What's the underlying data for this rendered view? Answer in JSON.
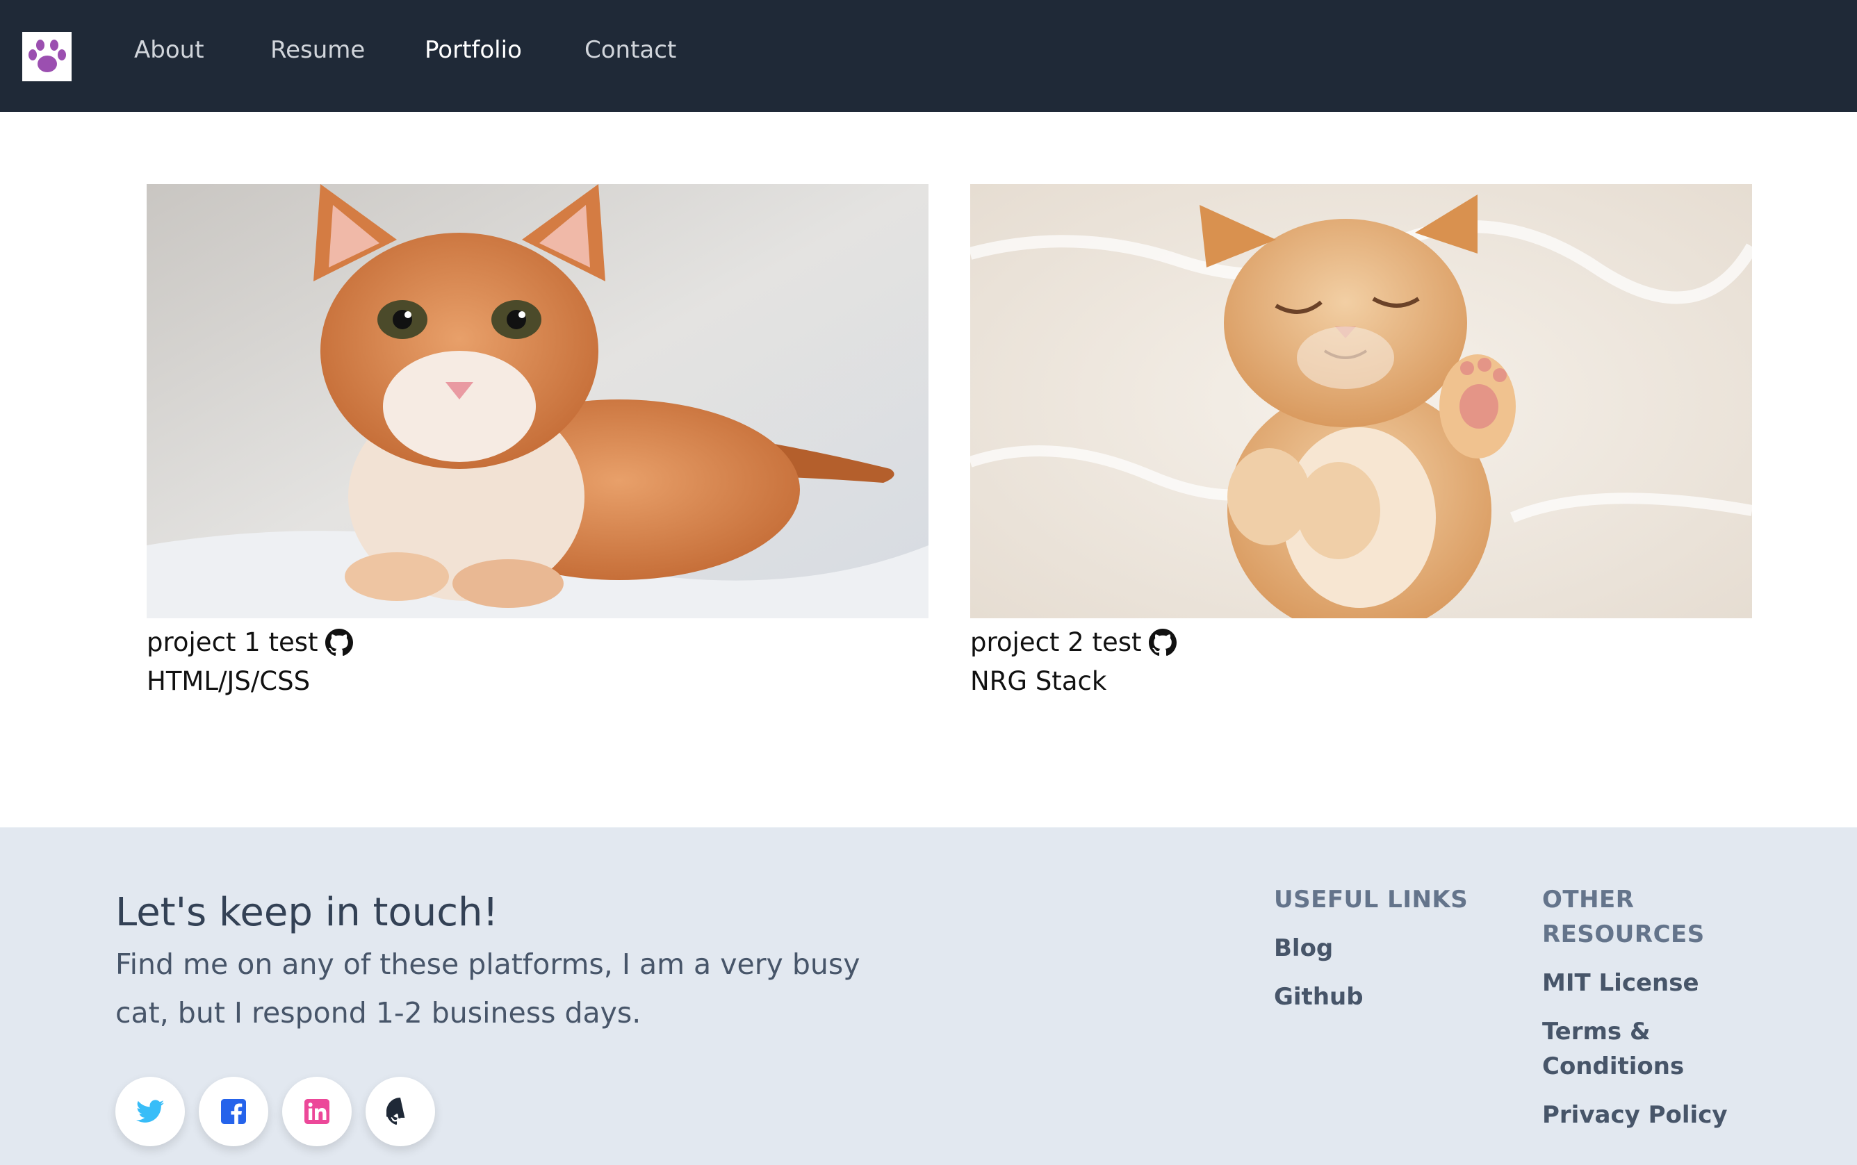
{
  "nav": {
    "logo_icon": "paw-icon",
    "logo_color": "#9b4fb0",
    "links": [
      {
        "label": "About"
      },
      {
        "label": "Resume"
      },
      {
        "label": "Portfolio",
        "active": true
      },
      {
        "label": "Contact"
      }
    ]
  },
  "projects": [
    {
      "title": "project 1 test",
      "tech": "HTML/JS/CSS",
      "image": "orange-kitten-lying-on-bed",
      "link_icon": "github-icon"
    },
    {
      "title": "project 2 test",
      "tech": "NRG Stack",
      "image": "orange-kitten-sleeping-on-fur",
      "link_icon": "github-icon"
    }
  ],
  "footer": {
    "heading": "Let's keep in touch!",
    "subheading": "Find me on any of these platforms, I am a very busy cat, but I respond 1-2 business days.",
    "social": [
      {
        "icon": "twitter-icon",
        "color": "#38bdf8"
      },
      {
        "icon": "facebook-icon",
        "color": "#2563eb"
      },
      {
        "icon": "linkedin-icon",
        "color": "#ec4899"
      },
      {
        "icon": "github-icon",
        "color": "#1f2937"
      }
    ],
    "useful_links": {
      "heading": "USEFUL LINKS",
      "items": [
        "Blog",
        "Github"
      ]
    },
    "other_resources": {
      "heading": "OTHER RESOURCES",
      "items": [
        "MIT License",
        "Terms & Conditions",
        "Privacy Policy"
      ]
    }
  }
}
